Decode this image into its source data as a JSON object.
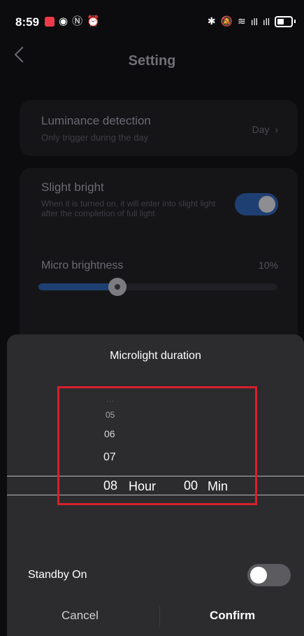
{
  "status_bar": {
    "time": "8:59"
  },
  "header": {
    "title": "Setting"
  },
  "luminance": {
    "label": "Luminance detection",
    "sub": "Only trigger during the day",
    "value": "Day"
  },
  "slight_bright": {
    "label": "Slight bright",
    "description": "When it is turned on, it will enter into slight light after the completion of full light",
    "enabled": true
  },
  "micro_brightness": {
    "label": "Micro brightness",
    "value_text": "10%",
    "level": 0.33
  },
  "sheet": {
    "title": "Microlight duration",
    "picker": {
      "dots": "···",
      "hours_above": [
        "05",
        "06",
        "07"
      ],
      "hour_value": "08",
      "hour_unit": "Hour",
      "minute_value": "00",
      "minute_unit": "Min"
    },
    "standby": {
      "label": "Standby On",
      "enabled": false
    },
    "cancel_label": "Cancel",
    "confirm_label": "Confirm"
  },
  "colors": {
    "accent": "#1e3f72",
    "highlight": "#d81f2c",
    "sheet": "#2c2c2e"
  }
}
